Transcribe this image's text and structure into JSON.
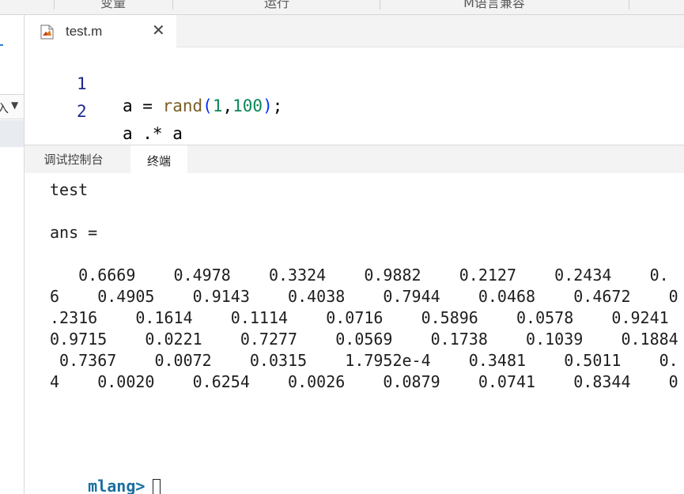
{
  "toolbar": {
    "sections": [
      "变量",
      "运行",
      "M语言兼容"
    ]
  },
  "sidebar": {
    "dropdown_text": "入"
  },
  "editor": {
    "tab": {
      "filename": "test.m",
      "close_label": "✕",
      "icon": "matlab-file-icon"
    },
    "lines": [
      {
        "number": "1",
        "code": "a = rand(1,100);"
      },
      {
        "number": "2",
        "code": "a .* a"
      }
    ]
  },
  "panel": {
    "tabs": [
      {
        "label": "调试控制台",
        "active": false
      },
      {
        "label": "终端",
        "active": true
      }
    ]
  },
  "terminal": {
    "lines": [
      "test",
      "",
      "ans =",
      "",
      "   0.6669    0.4978    0.3324    0.9882    0.2127    0.2434    0.",
      "6    0.4905    0.9143    0.4038    0.7944    0.0468    0.4672    0",
      ".2316    0.1614    0.1114    0.0716    0.5896    0.0578    0.9241",
      "0.9715    0.0221    0.7277    0.0569    0.1738    0.1039    0.1884",
      " 0.7367    0.0072    0.0315    1.7952e-4    0.3481    0.5011    0.",
      "4    0.0020    0.6254    0.0026    0.0879    0.0741    0.8344    0"
    ],
    "prompt": "mlang>"
  },
  "colors": {
    "accent": "#2a7fd4",
    "line_number": "#1d2a8c",
    "function": "#795e26",
    "number": "#098658",
    "prompt": "#1a6f9f"
  }
}
